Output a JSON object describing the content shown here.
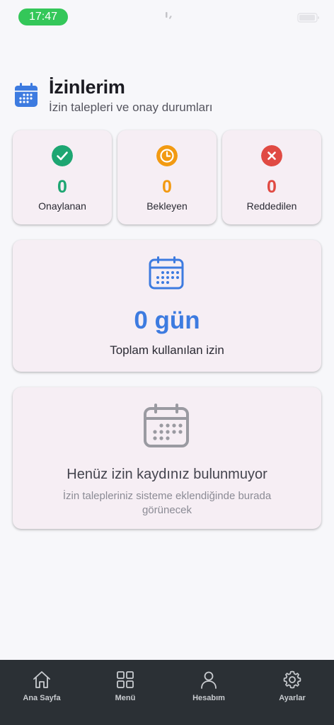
{
  "status_bar": {
    "time": "17:47",
    "time_pill_color": "#34c759"
  },
  "header": {
    "title": "İzinlerim",
    "subtitle": "İzin talepleri ve onay durumları",
    "icon": "calendar-icon",
    "accent_color": "#3d7be0"
  },
  "stats": [
    {
      "key": "approved",
      "label": "Onaylanan",
      "value": "0",
      "icon": "check-circle-icon",
      "color": "#1ea672"
    },
    {
      "key": "pending",
      "label": "Bekleyen",
      "value": "0",
      "icon": "clock-icon",
      "color": "#f29a12"
    },
    {
      "key": "rejected",
      "label": "Reddedilen",
      "value": "0",
      "icon": "x-circle-icon",
      "color": "#e04a43"
    }
  ],
  "total": {
    "value": "0 gün",
    "label": "Toplam kullanılan izin",
    "icon": "calendar-icon",
    "color": "#3d7be0"
  },
  "empty_state": {
    "title": "Henüz izin kaydınız bulunmuyor",
    "description": "İzin talepleriniz sisteme eklendiğinde burada görünecek",
    "icon": "calendar-icon"
  },
  "bottom_nav": [
    {
      "label": "Ana Sayfa",
      "icon": "home-icon"
    },
    {
      "label": "Menü",
      "icon": "grid-icon"
    },
    {
      "label": "Hesabım",
      "icon": "user-icon"
    },
    {
      "label": "Ayarlar",
      "icon": "gear-icon"
    }
  ]
}
